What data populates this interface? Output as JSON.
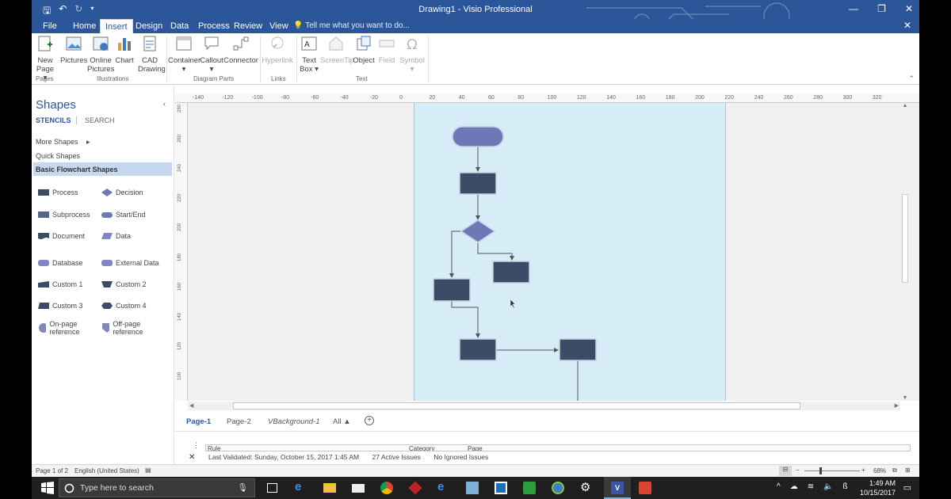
{
  "window": {
    "title": "Drawing1 - Visio Professional"
  },
  "tabs": [
    "File",
    "Home",
    "Insert",
    "Design",
    "Data",
    "Process",
    "Review",
    "View"
  ],
  "active_tab": "Insert",
  "tell_me": "Tell me what you want to do...",
  "ribbon": {
    "new_page": "New Page",
    "pictures": "Pictures",
    "online_pictures": "Online Pictures",
    "chart": "Chart",
    "cad_drawing": "CAD Drawing",
    "container": "Container",
    "callout": "Callout",
    "connector": "Connector",
    "hyperlink": "Hyperlink",
    "text_box": "Text Box",
    "screentip": "ScreenTip",
    "object": "Object",
    "field": "Field",
    "symbol": "Symbol",
    "groups": {
      "pages": "Pages",
      "illustrations": "Illustrations",
      "diagram_parts": "Diagram Parts",
      "links": "Links",
      "text": "Text"
    }
  },
  "shapes_panel": {
    "title": "Shapes",
    "stencils": "STENCILS",
    "search": "SEARCH",
    "more_shapes": "More Shapes",
    "quick_shapes": "Quick Shapes",
    "basic_flowchart": "Basic Flowchart Shapes",
    "items": [
      {
        "label": "Process",
        "icon": "process-shape-icon"
      },
      {
        "label": "Decision",
        "icon": "decision-shape-icon"
      },
      {
        "label": "Subprocess",
        "icon": "subprocess-shape-icon"
      },
      {
        "label": "Start/End",
        "icon": "start-end-shape-icon"
      },
      {
        "label": "Document",
        "icon": "document-shape-icon"
      },
      {
        "label": "Data",
        "icon": "data-shape-icon"
      },
      {
        "label": "Database",
        "icon": "database-shape-icon"
      },
      {
        "label": "External Data",
        "icon": "external-data-shape-icon"
      },
      {
        "label": "Custom 1",
        "icon": "custom1-shape-icon"
      },
      {
        "label": "Custom 2",
        "icon": "custom2-shape-icon"
      },
      {
        "label": "Custom 3",
        "icon": "custom3-shape-icon"
      },
      {
        "label": "Custom 4",
        "icon": "custom4-shape-icon"
      },
      {
        "label": "On-page reference",
        "icon": "on-page-reference-icon"
      },
      {
        "label": "Off-page reference",
        "icon": "off-page-reference-icon"
      }
    ]
  },
  "ruler": {
    "h_ticks": [
      "-140",
      "-120",
      "-100",
      "-80",
      "-60",
      "-40",
      "-20",
      "0",
      "20",
      "40",
      "60",
      "80",
      "100",
      "120",
      "140",
      "160",
      "180",
      "200",
      "220",
      "240",
      "260",
      "280",
      "300",
      "320"
    ],
    "v_ticks": [
      "280",
      "260",
      "240",
      "220",
      "200",
      "180",
      "160",
      "140",
      "120",
      "100"
    ]
  },
  "page_tabs": [
    "Page-1",
    "Page-2",
    "VBackground-1",
    "All"
  ],
  "issues": {
    "columns": [
      "Rule",
      "Category",
      "Page"
    ],
    "last_validated": "Last Validated: Sunday, October 15, 2017 1:45 AM",
    "active_issues": "27 Active Issues",
    "ignored": "No Ignored Issues"
  },
  "statusbar": {
    "page": "Page 1 of 2",
    "language": "English (United States)",
    "zoom": "68%"
  },
  "taskbar": {
    "search_placeholder": "Type here to search",
    "time": "1:49 AM",
    "date": "10/15/2017"
  },
  "colors": {
    "accent": "#2b579a",
    "page_bg": "#d6ecf7",
    "shape_fill": "#3a4c66",
    "start_end_fill": "#6e78b6"
  }
}
